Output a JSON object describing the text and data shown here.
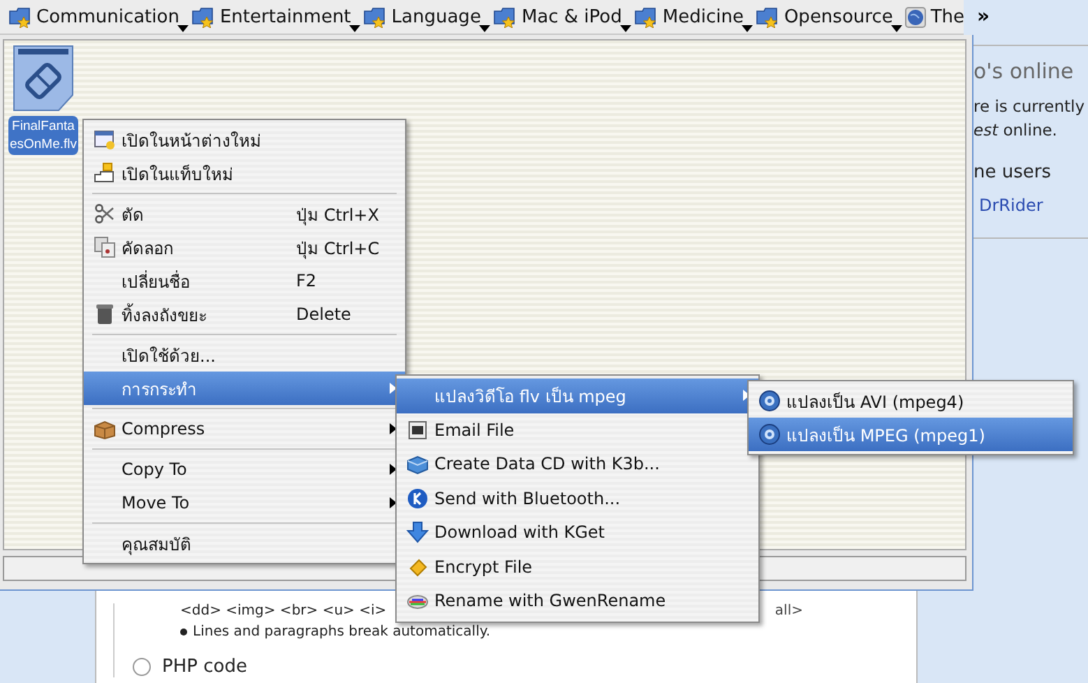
{
  "bookmarks": {
    "items": [
      {
        "label": "Communication"
      },
      {
        "label": "Entertainment"
      },
      {
        "label": "Language"
      },
      {
        "label": "Mac & iPod"
      },
      {
        "label": "Medicine"
      },
      {
        "label": "Opensource"
      },
      {
        "label": "The"
      }
    ],
    "more": "»"
  },
  "file_manager": {
    "file": {
      "lines": [
        "FinalFanta",
        "esOnMe.flv"
      ],
      "selected": true
    }
  },
  "context_menu": {
    "items": [
      {
        "kind": "item",
        "label": "เปิดในหน้าต่างใหม่",
        "selected": false
      },
      {
        "kind": "item",
        "label": "เปิดในแท็บใหม่",
        "selected": false
      },
      {
        "kind": "separator"
      },
      {
        "kind": "item",
        "label": "ตัด",
        "shortcut": "ปุ่ม Ctrl+X",
        "selected": false
      },
      {
        "kind": "item",
        "label": "คัดลอก",
        "shortcut": "ปุ่ม Ctrl+C",
        "selected": false
      },
      {
        "kind": "item",
        "label": "เปลี่ยนชื่อ",
        "shortcut": "F2",
        "selected": false
      },
      {
        "kind": "item",
        "label": "ทิ้งลงถังขยะ",
        "shortcut": "Delete",
        "selected": false
      },
      {
        "kind": "separator"
      },
      {
        "kind": "item",
        "label": "เปิดใช้ด้วย...",
        "selected": false
      },
      {
        "kind": "item",
        "label": "การกระทำ",
        "submenu": true,
        "selected": true
      },
      {
        "kind": "separator"
      },
      {
        "kind": "item",
        "label": "Compress",
        "submenu": true,
        "selected": false
      },
      {
        "kind": "separator"
      },
      {
        "kind": "item",
        "label": "Copy To",
        "submenu": true,
        "selected": false
      },
      {
        "kind": "item",
        "label": "Move To",
        "submenu": true,
        "selected": false
      },
      {
        "kind": "separator"
      },
      {
        "kind": "item",
        "label": "คุณสมบัติ",
        "selected": false
      }
    ]
  },
  "actions_menu": {
    "items": [
      {
        "label": "แปลงวิดีโอ flv เป็น mpeg",
        "submenu": true,
        "selected": true
      },
      {
        "label": "Email File",
        "selected": false
      },
      {
        "label": "Create Data CD with K3b...",
        "selected": false
      },
      {
        "label": "Send with Bluetooth...",
        "selected": false
      },
      {
        "label": "Download with KGet",
        "selected": false
      },
      {
        "label": "Encrypt File",
        "selected": false
      },
      {
        "label": "Rename with GwenRename",
        "selected": false
      }
    ]
  },
  "convert_menu": {
    "items": [
      {
        "label": "แปลงเป็น AVI (mpeg4)",
        "selected": false
      },
      {
        "label": "แปลงเป็น MPEG (mpeg1)",
        "selected": true
      }
    ]
  },
  "sidebar": {
    "title": "o's online",
    "text_1": "re is currently",
    "text_2": "*est* online.",
    "users_heading": "ne  users",
    "user": "DrRider"
  },
  "content": {
    "tags_line": "<dd> <img> <br> <u> <i>",
    "tags_tail": "all>",
    "bullet": "Lines and paragraphs break automatically.",
    "radio": {
      "label": "PHP code",
      "selected": false
    }
  }
}
